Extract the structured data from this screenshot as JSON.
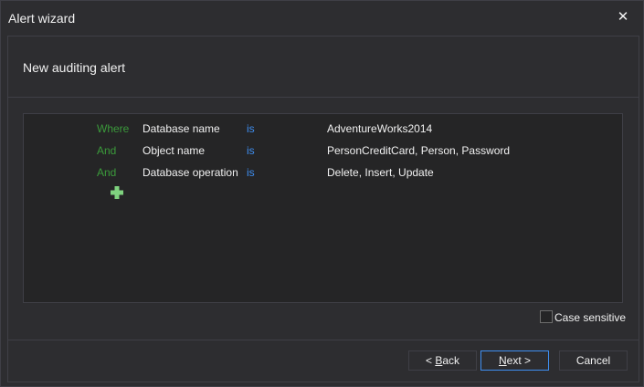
{
  "window": {
    "title": "Alert wizard",
    "close_glyph": "✕"
  },
  "header": {
    "title": "New auditing alert"
  },
  "conditions": [
    {
      "keyword": "Where",
      "field": "Database name",
      "operator": "is",
      "value": "AdventureWorks2014"
    },
    {
      "keyword": "And",
      "field": "Object name",
      "operator": "is",
      "value": "PersonCreditCard, Person, Password"
    },
    {
      "keyword": "And",
      "field": "Database operation",
      "operator": "is",
      "value": "Delete, Insert, Update"
    }
  ],
  "add_condition": {
    "icon": "plus-icon",
    "color": "#7fd37f"
  },
  "options": {
    "case_sensitive_label": "Case sensitive",
    "case_sensitive_checked": false
  },
  "buttons": {
    "back_prefix": "< ",
    "back_accel": "B",
    "back_rest": "ack",
    "next_accel": "N",
    "next_rest": "ext >",
    "cancel": "Cancel"
  },
  "colors": {
    "background": "#2d2d30",
    "panel": "#252526",
    "keyword": "#3b9a3b",
    "operator": "#3e8ef0",
    "border": "#3f3f46"
  }
}
